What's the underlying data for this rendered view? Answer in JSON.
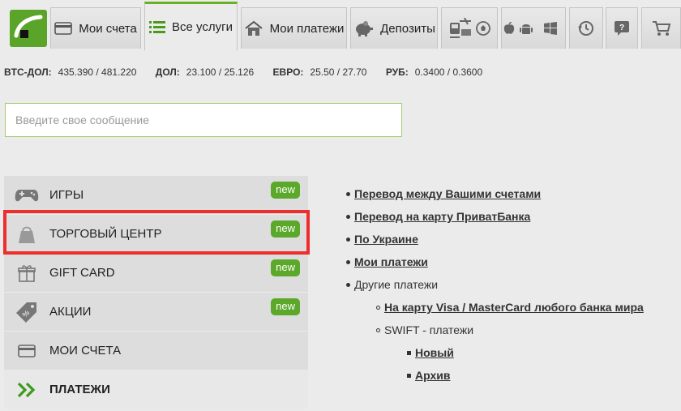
{
  "nav": {
    "tabs": [
      {
        "label": "Мои счета",
        "icon": "card-icon"
      },
      {
        "label": "Все услуги",
        "icon": "list-icon",
        "active": true
      },
      {
        "label": "Мои платежи",
        "icon": "house-icon"
      },
      {
        "label": "Депозиты",
        "icon": "piggy-bank-icon"
      }
    ],
    "accent": "#6ab023"
  },
  "rates": [
    {
      "key": "BTC-ДОЛ:",
      "value": "435.390 / 481.220"
    },
    {
      "key": "ДОЛ:",
      "value": "23.100 / 25.126"
    },
    {
      "key": "ЕВРО:",
      "value": "25.50 / 27.70"
    },
    {
      "key": "РУБ:",
      "value": "0.3400 / 0.3600"
    }
  ],
  "message": {
    "placeholder": "Введите свое сообщение",
    "value": ""
  },
  "menu": {
    "items": [
      {
        "label": "ИГРЫ",
        "icon": "gamepad-icon",
        "badge": "new"
      },
      {
        "label": "ТОРГОВЫЙ ЦЕНТР",
        "icon": "shopping-bag-icon",
        "badge": "new"
      },
      {
        "label": "GIFT CARD",
        "icon": "gift-icon",
        "badge": "new"
      },
      {
        "label": "АКЦИИ",
        "icon": "discount-tag-icon",
        "badge": "new"
      },
      {
        "label": "МОИ СЧЕТА",
        "icon": "card-icon"
      },
      {
        "label": "ПЛАТЕЖИ",
        "icon": "double-chevron-icon"
      }
    ],
    "highlight_color": "#ee2d2d",
    "badge_color": "#5ba82a"
  },
  "links": {
    "items": [
      "Перевод между Вашими счетами",
      "Перевод на карту ПриватБанка",
      "По Украине",
      "Мои платежи",
      "Другие платежи",
      "На карту Visa / MasterCard любого банка мира",
      "SWIFT - платежи",
      "Новый",
      "Архив"
    ]
  }
}
